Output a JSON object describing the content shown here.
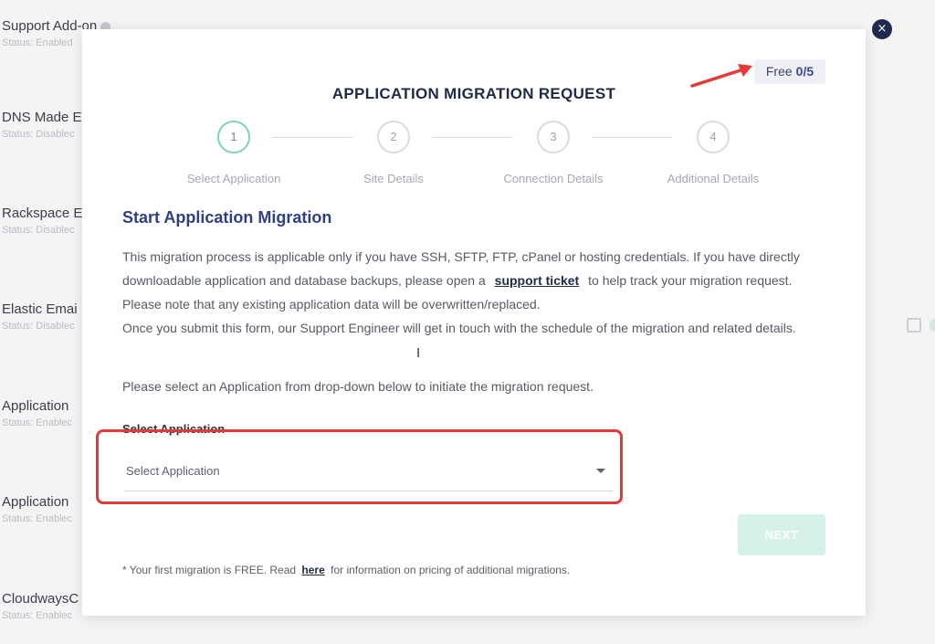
{
  "background_list": [
    {
      "title": "Support Add-on",
      "status": "Status: Enabled",
      "info": true
    },
    {
      "title": "DNS Made E",
      "status": "Status: Disablec"
    },
    {
      "title": "Rackspace E",
      "status": "Status: Disablec"
    },
    {
      "title": "Elastic Emai",
      "status": "Status: Disablec"
    },
    {
      "title": "Application",
      "status": "Status: Enablec"
    },
    {
      "title": "Application",
      "status": "Status: Enablec"
    },
    {
      "title": "CloudwaysC",
      "status": "Status: Enablec"
    }
  ],
  "close_icon": "×",
  "free_badge": {
    "label": "Free",
    "count": "0/5"
  },
  "modal": {
    "title": "APPLICATION MIGRATION REQUEST",
    "steps": [
      {
        "num": "1",
        "label": "Select Application",
        "active": true
      },
      {
        "num": "2",
        "label": "Site Details"
      },
      {
        "num": "3",
        "label": "Connection Details"
      },
      {
        "num": "4",
        "label": "Additional Details"
      }
    ],
    "section_title": "Start Application Migration",
    "paragraph": {
      "part1": "This migration process is applicable only if you have SSH, SFTP, FTP, cPanel or hosting credentials. If you have directly downloadable application and database backups, please open a",
      "link": "support ticket",
      "part2": "to help track your migration request. Please note that any existing application data will be overwritten/replaced.",
      "part3": "Once you submit this form, our Support Engineer will get in touch with the schedule of the migration and related details."
    },
    "instruction": "Please select an Application from drop-down below to initiate the migration request.",
    "select_label": "Select Application",
    "select_value": "Select Application",
    "next_label": "NEXT",
    "footnote": {
      "part1": "* Your first migration is FREE. Read",
      "link": "here",
      "part2": "for information on pricing of additional migrations."
    }
  },
  "colors": {
    "accent": "#2f3f83",
    "highlight": "#e53935",
    "step_active": "#7ed1c0"
  }
}
